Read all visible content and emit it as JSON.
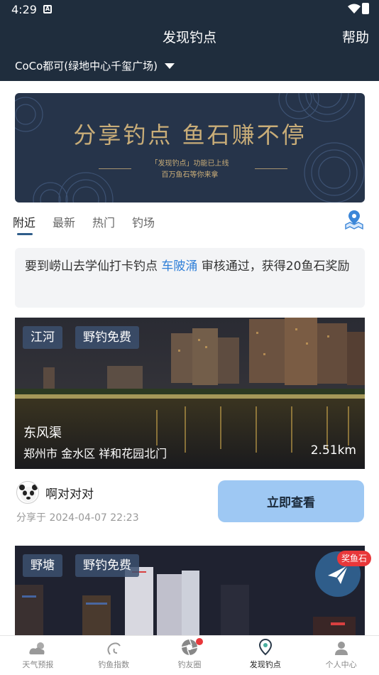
{
  "status": {
    "time": "4:29"
  },
  "header": {
    "title": "发现钓点",
    "help": "帮助",
    "location": "CoCo都可(绿地中心千玺广场)"
  },
  "banner": {
    "title": "分享钓点  鱼石赚不停",
    "subtitle_line1": "「发现钓点」功能已上线",
    "subtitle_line2": "百万鱼石等你来拿"
  },
  "tabs": [
    "附近",
    "最新",
    "热门",
    "钓场"
  ],
  "notice": {
    "before": "要到崂山去学仙打卡钓点 ",
    "highlight": "车陂涌",
    "after": " 审核通过，获得20鱼石奖励"
  },
  "card1": {
    "tags": [
      "江河",
      "野钓免费"
    ],
    "name": "东风渠",
    "address": "郑州市 金水区 祥和花园北门",
    "distance": "2.51km",
    "user": "啊对对对",
    "share_time": "分享于 2024-04-07 22:23",
    "button": "立即查看"
  },
  "card2": {
    "tags": [
      "野塘",
      "野钓免费"
    ]
  },
  "fab": {
    "badge": "奖鱼石"
  },
  "nav": [
    "天气预报",
    "钓鱼指数",
    "钓友圈",
    "发现钓点",
    "个人中心"
  ],
  "colors": {
    "header_bg": "#1f2d3d",
    "accent": "#2f5d8a",
    "highlight": "#2f7fd8",
    "button_bg": "#9ec8f3",
    "badge": "#e8373a"
  }
}
